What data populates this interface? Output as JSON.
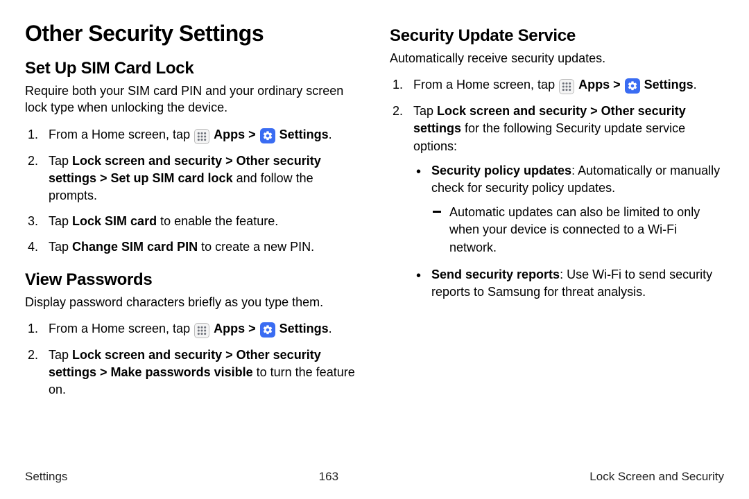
{
  "page_title": "Other Security Settings",
  "left": {
    "sec1_title": "Set Up SIM Card Lock",
    "sec1_lead": "Require both your SIM card PIN and your ordinary screen lock type when unlocking the device.",
    "s1_i1_a": "From a Home screen, tap ",
    "apps": "Apps",
    "chev": " > ",
    "settings": "Settings",
    "period": ".",
    "s1_i2_a": "Tap ",
    "s1_i2_b": "Lock screen and security",
    "s1_i2_c": "Other security settings",
    "s1_i2_d": "Set up SIM card lock",
    "s1_i2_e": " and follow the prompts.",
    "s1_i3_a": "Tap ",
    "s1_i3_b": "Lock SIM card",
    "s1_i3_c": " to enable the feature.",
    "s1_i4_a": "Tap ",
    "s1_i4_b": "Change SIM card PIN",
    "s1_i4_c": " to create a new PIN.",
    "sec2_title": "View Passwords",
    "sec2_lead": "Display password characters briefly as you type them.",
    "s2_i2_a": "Tap ",
    "s2_i2_b": "Lock screen and security",
    "s2_i2_c": "Other security settings",
    "s2_i2_d": "Make passwords visible",
    "s2_i2_e": " to turn the feature on."
  },
  "right": {
    "sec3_title": "Security Update Service",
    "sec3_lead": "Automatically receive security updates.",
    "s3_i2_a": "Tap ",
    "s3_i2_b": "Lock screen and security",
    "s3_i2_c": "Other security settings",
    "s3_i2_d": " for the following Security update service options:",
    "b1_a": "Security policy updates",
    "b1_b": ": Automatically or manually check for security policy updates.",
    "b1_sub": "Automatic updates can also be limited to only when your device is connected to a Wi-Fi network.",
    "b2_a": "Send security reports",
    "b2_b": ": Use Wi-Fi to send security reports to Samsung for threat analysis."
  },
  "footer": {
    "left": "Settings",
    "center": "163",
    "right": "Lock Screen and Security"
  }
}
